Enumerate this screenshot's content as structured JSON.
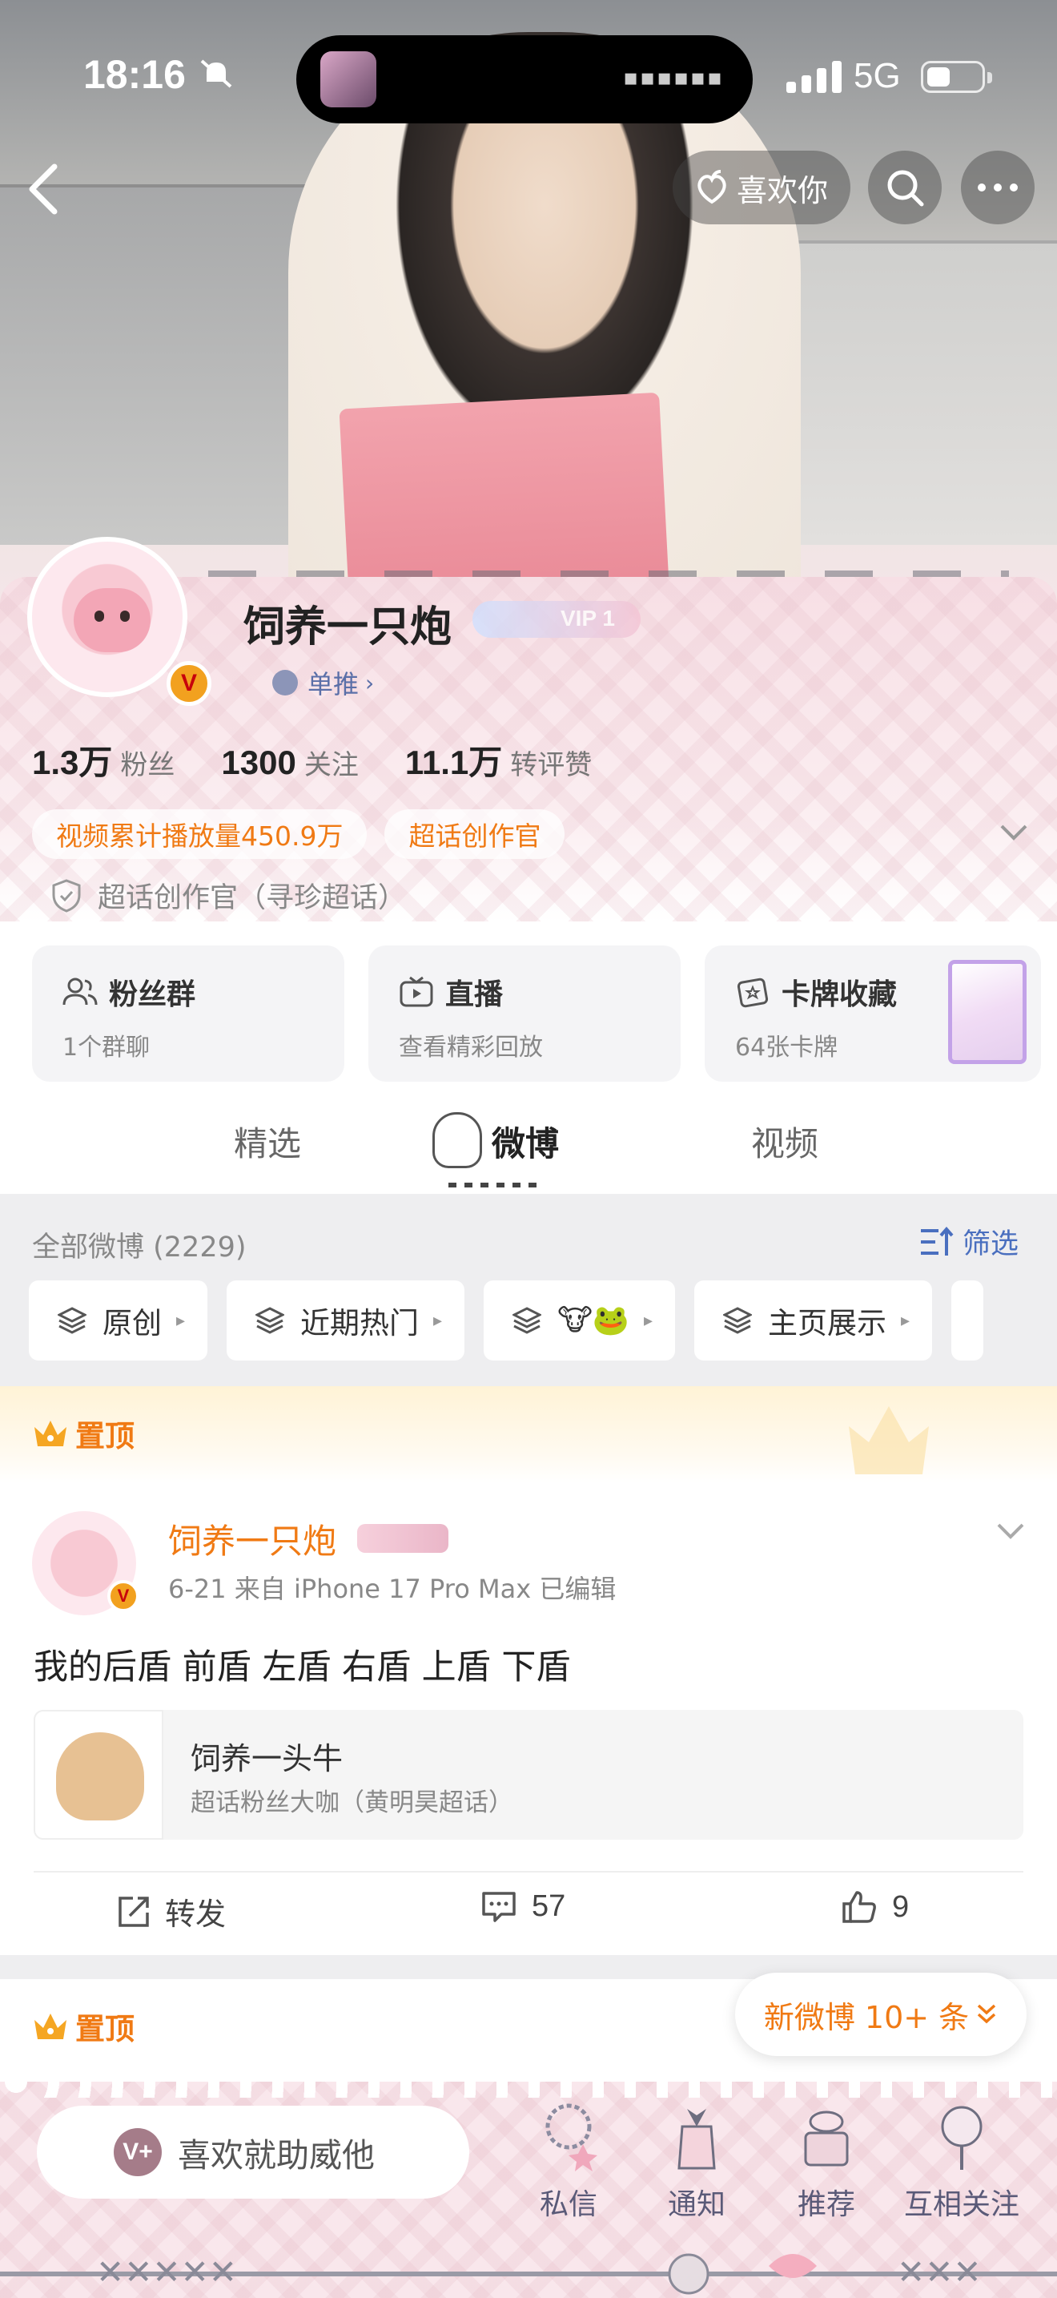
{
  "status_bar": {
    "time": "18:16",
    "network": "5G"
  },
  "header": {
    "like_label": "喜欢你"
  },
  "profile": {
    "name": "饲养一只炮",
    "verify_mark": "V",
    "vip_text": "VIP 1",
    "dan_tui": "单推",
    "stats": [
      {
        "num": "1.3万",
        "label": "粉丝"
      },
      {
        "num": "1300",
        "label": "关注"
      },
      {
        "num": "11.1万",
        "label": "转评赞"
      }
    ],
    "tags": [
      "视频累计播放量450.9万",
      "超话创作官"
    ],
    "super_topic_line": "超话创作官（寻珍超话）"
  },
  "feature_cards": [
    {
      "title": "粉丝群",
      "sub": "1个群聊",
      "icon": "people-icon"
    },
    {
      "title": "直播",
      "sub": "查看精彩回放",
      "icon": "tv-icon"
    },
    {
      "title": "卡牌收藏",
      "sub": "64张卡牌",
      "icon": "card-icon"
    }
  ],
  "tabs": [
    "精选",
    "微博",
    "视频"
  ],
  "active_tab": "微博",
  "feed": {
    "all_count": "全部微博 (2229)",
    "filter_label": "筛选",
    "chips": [
      "原创",
      "近期热门",
      "🐮🐸",
      "主页展示"
    ]
  },
  "pinned_label": "置顶",
  "post": {
    "author": "饲养一只炮",
    "meta": "6-21  来自 iPhone 17 Pro Max  已编辑",
    "text": "我的后盾 前盾 左盾 右盾 上盾 下盾",
    "quote": {
      "title": "饲养一头牛",
      "sub": "超话粉丝大咖（黄明昊超话）"
    },
    "actions": {
      "repost": "转发",
      "comments": "57",
      "likes": "9"
    }
  },
  "new_posts": "新微博 10+ 条",
  "bottom_bar": {
    "support": "喜欢就助威他",
    "support_icon": "V+",
    "nav": [
      "私信",
      "通知",
      "推荐",
      "互相关注"
    ]
  },
  "colors": {
    "accent_orange": "#f07a14",
    "link_blue": "#4a6fbf",
    "verify_gold": "#f2a11f"
  }
}
